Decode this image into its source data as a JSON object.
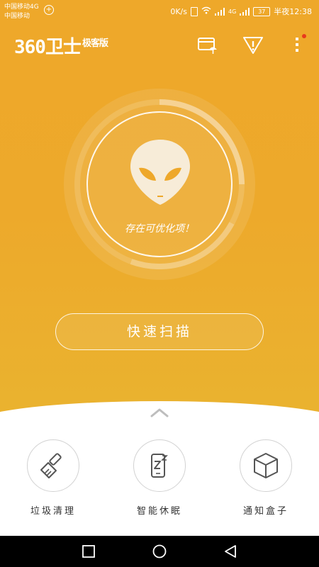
{
  "statusbar": {
    "carrier_line1": "中国移动4G",
    "carrier_line2": "中国移动",
    "network_speed": "0K/s",
    "network_type": "4G",
    "battery": "37",
    "time": "半夜12:38"
  },
  "header": {
    "logo_main": "360卫士",
    "logo_sub": "极客版",
    "icons": [
      "wallet-umbrella-icon",
      "warning-filter-icon",
      "more-vertical-icon"
    ],
    "notification_dot_color": "#e83a1c"
  },
  "scanner": {
    "status_text": "存在可优化项！",
    "icon": "alien-head-icon"
  },
  "scan_button": {
    "label": "快速扫描"
  },
  "tools": [
    {
      "label": "垃圾清理",
      "icon": "broom-icon"
    },
    {
      "label": "智能休眠",
      "icon": "phone-sleep-icon"
    },
    {
      "label": "通知盒子",
      "icon": "box-icon"
    }
  ],
  "colors": {
    "accent_top": "#eea82a",
    "accent_bottom": "#e8b633",
    "panel": "#ffffff"
  },
  "navbar": {
    "icons": [
      "square-recents-icon",
      "circle-home-icon",
      "triangle-back-icon"
    ]
  }
}
